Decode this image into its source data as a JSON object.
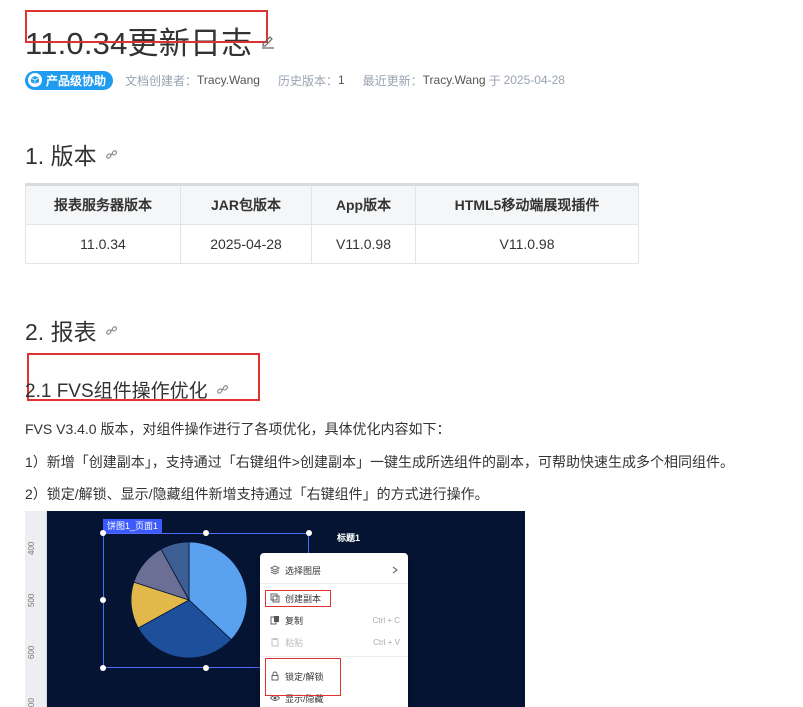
{
  "page": {
    "title": "11.0.34更新日志"
  },
  "meta": {
    "badge": "产品级协助",
    "creator_label": "文档创建者：",
    "creator": "Tracy.Wang",
    "history_label": "历史版本：",
    "history": "1",
    "updated_label": "最近更新：",
    "updated_by": "Tracy.Wang",
    "updated_on_word": "于",
    "updated_date": "2025-04-28"
  },
  "sections": {
    "s1": "1. 版本",
    "s2": "2. 报表",
    "s21": "2.1 FVS组件操作优化"
  },
  "version_table": {
    "headers": [
      "报表服务器版本",
      "JAR包版本",
      "App版本",
      "HTML5移动端展现插件"
    ],
    "row": [
      "11.0.34",
      "2025-04-28",
      "V11.0.98",
      "V11.0.98"
    ]
  },
  "body": {
    "intro": "FVS V3.4.0 版本，对组件操作进行了各项优化，具体优化内容如下：",
    "item1": "1）新增「创建副本」，支持通过「右键组件>创建副本」一键生成所选组件的副本，可帮助快速生成多个相同组件。",
    "item2": "2）锁定/解锁、显示/隐藏组件新增支持通过「右键组件」的方式进行操作。"
  },
  "screenshot": {
    "ruler_ticks": [
      "400",
      "500",
      "600",
      "00"
    ],
    "selection_label": "饼图1_页面1",
    "chart_title": "标题1",
    "context_menu": [
      {
        "label": "选择图层",
        "shortcut": ""
      },
      {
        "label": "创建副本",
        "shortcut": ""
      },
      {
        "label": "复制",
        "shortcut": "Ctrl + C"
      },
      {
        "label": "粘贴",
        "shortcut": "Ctrl + V"
      },
      {
        "label": "锁定/解锁",
        "shortcut": ""
      },
      {
        "label": "显示/隐藏",
        "shortcut": ""
      }
    ],
    "pie_slices": [
      {
        "value": 37,
        "color": "#5aa2f0"
      },
      {
        "value": 30,
        "color": "#1d4f9a"
      },
      {
        "value": 13,
        "color": "#e3b84a"
      },
      {
        "value": 12,
        "color": "#6b6f96"
      },
      {
        "value": 8,
        "color": "#3d5f93"
      }
    ]
  },
  "colors": {
    "accent": "#1f9bf0",
    "annotation": "#e0322f"
  }
}
